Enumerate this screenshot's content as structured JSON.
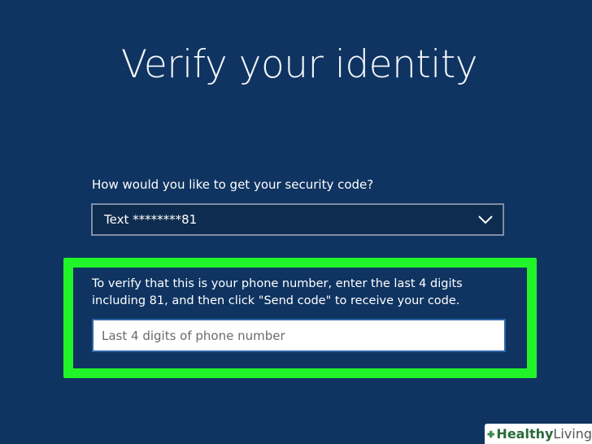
{
  "page": {
    "title": "Verify your identity"
  },
  "method": {
    "label": "How would you like to get your security code?",
    "selected": "Text ********81",
    "icon": "chevron-down-icon"
  },
  "verify": {
    "instructions": "To verify that this is your phone number, enter the last 4 digits including 81, and then click \"Send code\" to receive your code.",
    "input_placeholder": "Last 4 digits of phone number",
    "input_value": ""
  },
  "watermark": {
    "brand_part1": "Healthy",
    "brand_part2": "Living",
    "icon": "plus-icon"
  },
  "colors": {
    "background": "#0f3461",
    "select_background": "#0d2c4f",
    "highlight": "#22f42a",
    "input_border": "#2e64a8"
  }
}
